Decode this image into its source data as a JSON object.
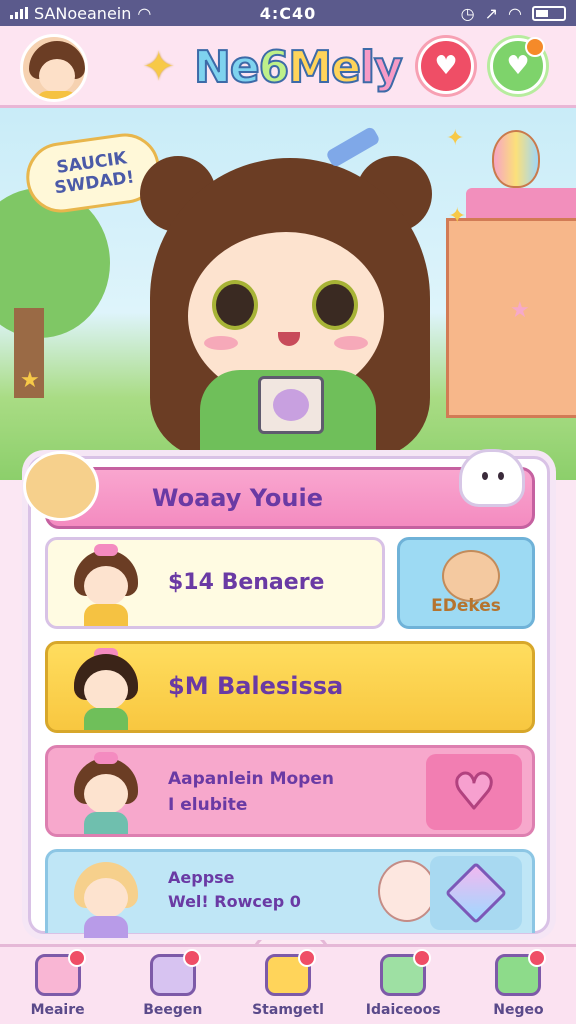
{
  "status_bar": {
    "carrier": "SANoeanein",
    "time": "4:C40"
  },
  "header": {
    "logo_text": [
      "Ne",
      "6",
      "Me",
      "ly"
    ],
    "logo_full": "Ne6Mely"
  },
  "hero": {
    "speech_line1": "SAUCIK",
    "speech_line2": "SWDAD!"
  },
  "panel": {
    "title": "Woaay Youie",
    "cards": [
      {
        "label": "$14 Benaere",
        "side_tag": "EDekes"
      },
      {
        "label": "$M Balesissa"
      },
      {
        "label_line1": "Aapanlein Mopen",
        "label_line2": "I elubite"
      },
      {
        "label_line1": "Aeppse",
        "label_line2": "Wel! Rowcep 0"
      }
    ]
  },
  "nav": {
    "items": [
      {
        "label": "Meaire",
        "icon": "house-character-icon",
        "badge": true
      },
      {
        "label": "Beegen",
        "icon": "photo-book-icon",
        "badge": true
      },
      {
        "label": "Stamgetl",
        "icon": "home-store-icon",
        "badge": true
      },
      {
        "label": "Idaiceoos",
        "icon": "tools-icon",
        "badge": true
      },
      {
        "label": "Negeo",
        "icon": "frog-face-icon",
        "badge": true
      }
    ]
  },
  "colors": {
    "accent_pink": "#f48bc0",
    "accent_yellow": "#ffd45a",
    "accent_blue": "#9ddaf3",
    "text_purple": "#6a3aa4"
  }
}
